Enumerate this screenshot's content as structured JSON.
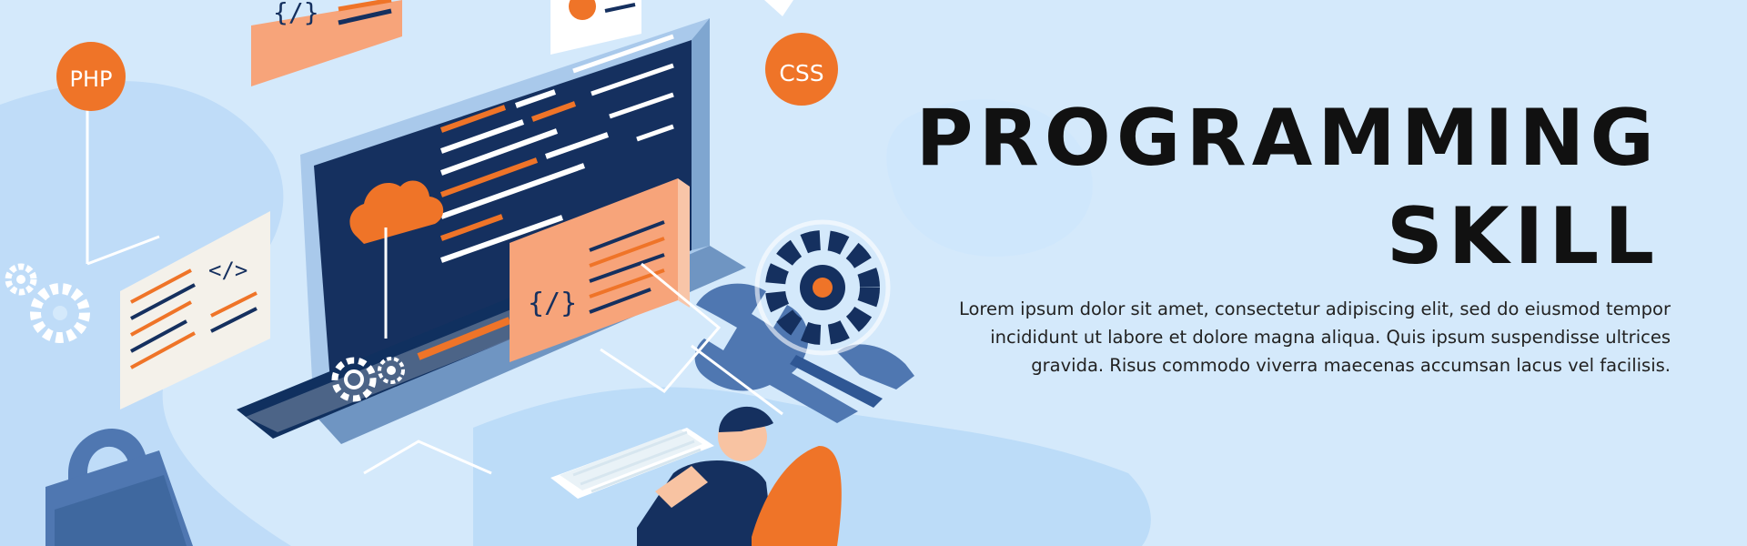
{
  "banner": {
    "title_line_1": "PROGRAMMING",
    "title_line_2": "SKILL",
    "body": "Lorem ipsum dolor sit amet, consectetur adipiscing elit, sed do eiusmod tempor incididunt ut labore et dolore magna aliqua. Quis ipsum suspendisse ultrices gravida. Risus commodo viverra maecenas accumsan lacus vel facilisis."
  },
  "illustration": {
    "php_badge": "PHP",
    "css_badge": "CSS",
    "code_tag": "{/}",
    "html_tag": "</>",
    "icons": [
      "cloud-icon",
      "gear-icon",
      "wrench-icon",
      "padlock-icon",
      "keyboard-icon",
      "chair-icon"
    ]
  },
  "colors": {
    "background": "#d4e9fb",
    "navy": "#15305f",
    "orange": "#f07b2f",
    "peach": "#f7a47a",
    "light_blue": "#b7d7f7",
    "white": "#ffffff"
  }
}
